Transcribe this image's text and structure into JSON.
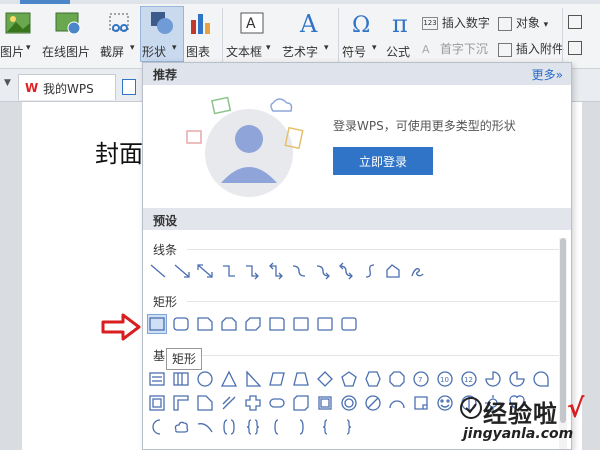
{
  "ribbon": {
    "pictures_label": "图片",
    "online_pictures_label": "在线图片",
    "screenshot_label": "截屏",
    "shapes_label": "形状",
    "chart_label": "图表",
    "textbox_label": "文本框",
    "wordart_label": "艺术字",
    "symbol_label": "符号",
    "formula_label": "公式",
    "insert_number_label": "插入数字",
    "object_label": "对象",
    "dropcap_label": "首字下沉",
    "insert_attachment_label": "插入附件"
  },
  "tabs": {
    "doc_tab_label": "我的WPS"
  },
  "document": {
    "visible_text": "封面"
  },
  "shapes_panel": {
    "header_title": "推荐",
    "more_label": "更多»",
    "promo_text": "登录WPS，可使用更多类型的形状",
    "login_button_label": "立即登录",
    "presets_header": "预设",
    "lines_group_label": "线条",
    "rect_group_label": "矩形",
    "basic_group_label": "基",
    "tooltip_text": "矩形"
  },
  "watermark": {
    "main_text": "经验啦",
    "url_text": "jingyanla.com"
  },
  "colors": {
    "accent": "#2f74c6",
    "shape_stroke": "#4a6fb0",
    "red_arrow": "#d81e1e"
  }
}
